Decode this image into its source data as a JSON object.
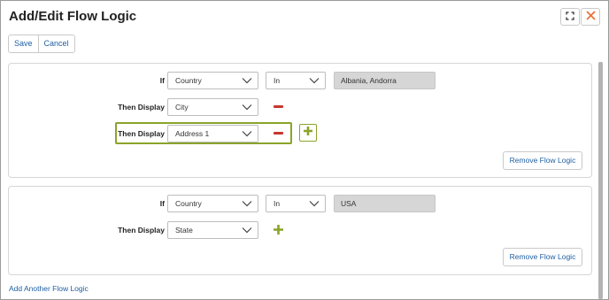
{
  "dialog": {
    "title": "Add/Edit Flow Logic"
  },
  "toolbar": {
    "save_label": "Save",
    "cancel_label": "Cancel"
  },
  "icons": {
    "maximize": "expand-icon",
    "close": "close-icon",
    "dropdown": "chevron-down-icon",
    "remove_row": "minus-icon",
    "add_row": "plus-icon"
  },
  "colors": {
    "link": "#1f5fa3",
    "close_icon": "#e8733a",
    "minus": "#c8372d",
    "plus": "#8aa32a",
    "readonly_bg": "#d6d6d6"
  },
  "flow_logics": [
    {
      "if_label": "If",
      "field": "Country",
      "operator": "In",
      "value": "Albania, Andorra",
      "then_rows": [
        {
          "label": "Then Display",
          "field": "City"
        },
        {
          "label": "Then Display",
          "field": "Address 1"
        }
      ],
      "remove_label": "Remove Flow Logic"
    },
    {
      "if_label": "If",
      "field": "Country",
      "operator": "In",
      "value": "USA",
      "then_rows": [
        {
          "label": "Then Display",
          "field": "State"
        }
      ],
      "remove_label": "Remove Flow Logic"
    }
  ],
  "add_another_label": "Add Another Flow Logic"
}
